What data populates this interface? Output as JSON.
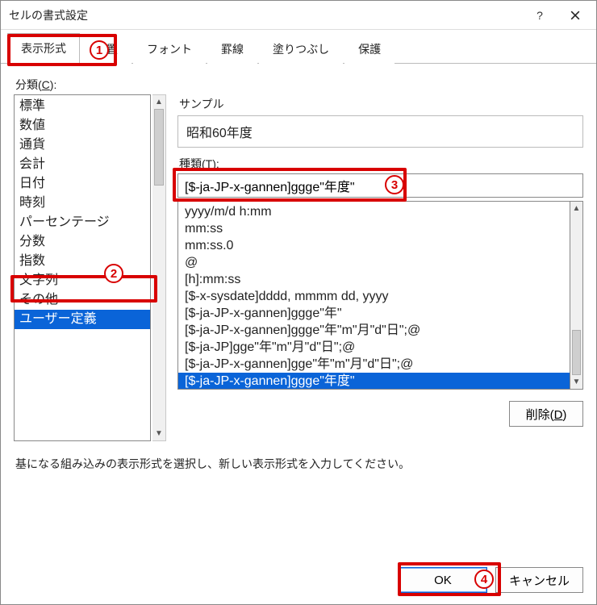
{
  "dialog": {
    "title": "セルの書式設定"
  },
  "tabs": [
    {
      "label": "表示形式",
      "active": true
    },
    {
      "label": "配置",
      "active": false
    },
    {
      "label": "フォント",
      "active": false
    },
    {
      "label": "罫線",
      "active": false
    },
    {
      "label": "塗りつぶし",
      "active": false
    },
    {
      "label": "保護",
      "active": false
    }
  ],
  "category": {
    "label_prefix": "分類(",
    "label_key": "C",
    "label_suffix": "):",
    "items": [
      "標準",
      "数値",
      "通貨",
      "会計",
      "日付",
      "時刻",
      "パーセンテージ",
      "分数",
      "指数",
      "文字列",
      "その他",
      "ユーザー定義"
    ],
    "selected_index": 11
  },
  "sample": {
    "title": "サンプル",
    "value": "昭和60年度"
  },
  "type": {
    "label_prefix": "種類(",
    "label_key": "T",
    "label_suffix": "):",
    "value": "[$-ja-JP-x-gannen]ggge\"年度\"",
    "options": [
      "yyyy/m/d h:mm",
      "mm:ss",
      "mm:ss.0",
      "@",
      "[h]:mm:ss",
      "[$-x-sysdate]dddd, mmmm dd, yyyy",
      "[$-ja-JP-x-gannen]ggge\"年\"",
      "[$-ja-JP-x-gannen]ggge\"年\"m\"月\"d\"日\";@",
      "[$-ja-JP]gge\"年\"m\"月\"d\"日\";@",
      "[$-ja-JP-x-gannen]gge\"年\"m\"月\"d\"日\";@",
      "[$-ja-JP-x-gannen]ggge\"年度\""
    ],
    "selected_index": 10
  },
  "buttons": {
    "delete_prefix": "削除(",
    "delete_key": "D",
    "delete_suffix": ")",
    "ok": "OK",
    "cancel": "キャンセル"
  },
  "hint": "基になる組み込みの表示形式を選択し、新しい表示形式を入力してください。",
  "annotations": {
    "n1": "1",
    "n2": "2",
    "n3": "3",
    "n4": "4"
  }
}
